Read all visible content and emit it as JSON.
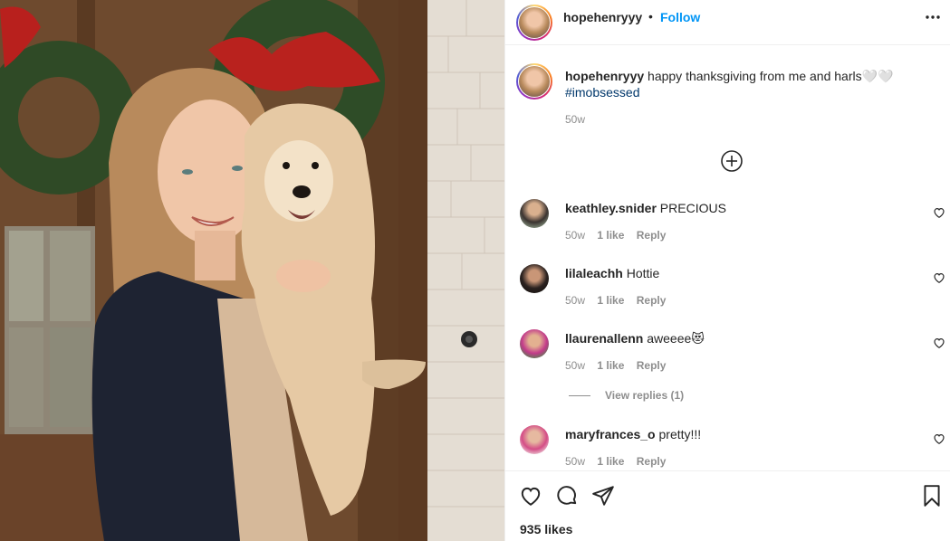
{
  "post": {
    "username": "hopehenryyy",
    "separator": "•",
    "follow_label": "Follow",
    "more_icon": "more-options-icon"
  },
  "caption": {
    "username": "hopehenryyy",
    "text": "happy thanksgiving from me and harls🤍🤍",
    "hashtag": "#imobsessed",
    "time": "50w"
  },
  "comments": [
    {
      "username": "keathley.snider",
      "text": "PRECIOUS",
      "time": "50w",
      "likes": "1 like",
      "reply": "Reply"
    },
    {
      "username": "lilaleachh",
      "text": "Hottie",
      "time": "50w",
      "likes": "1 like",
      "reply": "Reply"
    },
    {
      "username": "llaurenallenn",
      "text": "aweeee😻",
      "time": "50w",
      "likes": "1 like",
      "reply": "Reply"
    },
    {
      "username": "maryfrances_o",
      "text": "pretty!!!",
      "time": "50w",
      "likes": "1 like",
      "reply": "Reply"
    }
  ],
  "view_replies": "View replies (1)",
  "likes_count": "935 likes",
  "icons": [
    "heart-icon",
    "comment-icon",
    "share-icon",
    "bookmark-icon",
    "plus-circle-icon"
  ],
  "colors": {
    "follow": "#0095f6",
    "hashtag": "#00376b",
    "muted": "#8e8e8e",
    "text": "#262626"
  }
}
